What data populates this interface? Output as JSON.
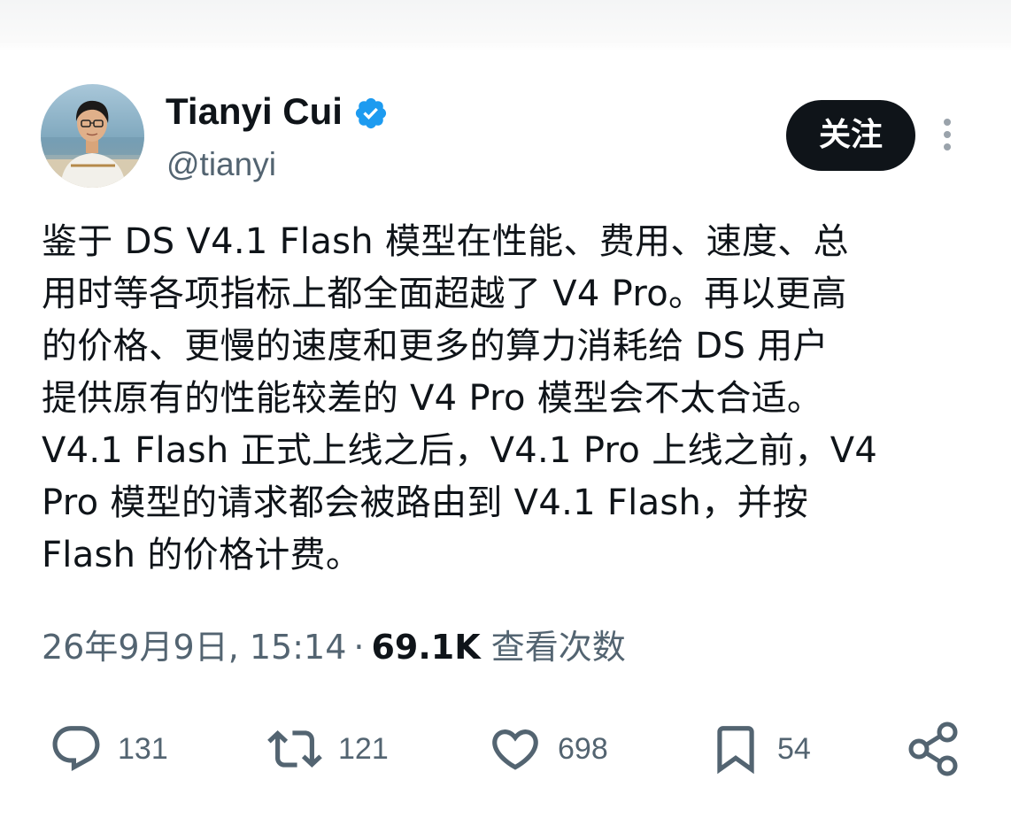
{
  "author": {
    "name": "Tianyi Cui",
    "handle": "@tianyi",
    "verified": true
  },
  "follow_button": {
    "label": "关注"
  },
  "tweet": {
    "lines": [
      "鉴于 DS V4.1 Flash 模型在性能、费用、速度、总",
      "用时等各项指标上都全面超越了 V4 Pro。再以更高",
      "的价格、更慢的速度和更多的算力消耗给 DS 用户",
      "提供原有的性能较差的 V4 Pro 模型会不太合适。",
      "V4.1 Flash 正式上线之后，V4.1 Pro 上线之前，V4",
      "Pro 模型的请求都会被路由到 V4.1 Flash，并按",
      "Flash 的价格计费。"
    ]
  },
  "meta": {
    "timestamp": "26年9月9日, 15:14",
    "separator": "·",
    "views_count": "69.1K",
    "views_label": "查看次数"
  },
  "actions": {
    "reply": {
      "icon": "reply-icon",
      "count": "131"
    },
    "retweet": {
      "icon": "retweet-icon",
      "count": "121"
    },
    "like": {
      "icon": "heart-icon",
      "count": "698"
    },
    "bookmark": {
      "icon": "bookmark-icon",
      "count": "54"
    },
    "share": {
      "icon": "share-icon"
    }
  },
  "colors": {
    "text_primary": "#0f1419",
    "text_secondary": "#536471",
    "verified_badge": "#1d9bf0",
    "follow_button_bg": "#0f1419"
  }
}
